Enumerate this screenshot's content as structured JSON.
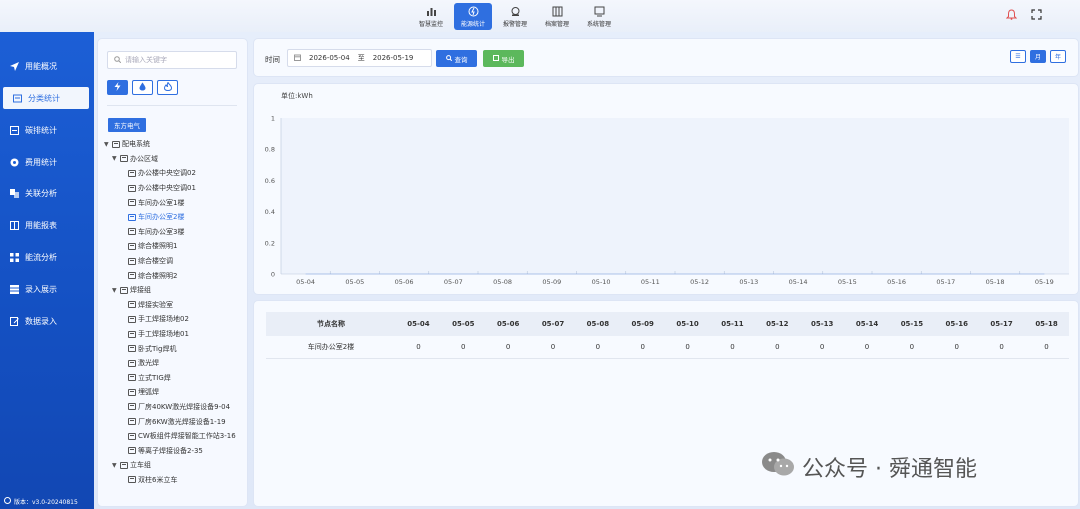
{
  "nav": {
    "items": [
      {
        "label": "智慧监控",
        "icon": "bar-chart-icon"
      },
      {
        "label": "能源统计",
        "icon": "energy-icon",
        "active": true
      },
      {
        "label": "报警管理",
        "icon": "alarm-icon"
      },
      {
        "label": "档案管理",
        "icon": "archive-icon"
      },
      {
        "label": "系统管理",
        "icon": "monitor-icon"
      }
    ]
  },
  "sidebar": {
    "items": [
      {
        "label": "用能概况",
        "icon": "send-icon"
      },
      {
        "label": "分类统计",
        "icon": "category-icon",
        "active": true
      },
      {
        "label": "碳排统计",
        "icon": "carbon-icon"
      },
      {
        "label": "费用统计",
        "icon": "cost-icon"
      },
      {
        "label": "关联分析",
        "icon": "link-icon"
      },
      {
        "label": "用能报表",
        "icon": "report-icon"
      },
      {
        "label": "能流分析",
        "icon": "flow-icon"
      },
      {
        "label": "录入展示",
        "icon": "input-display-icon"
      },
      {
        "label": "数据录入",
        "icon": "data-entry-icon"
      }
    ],
    "version": "版本：v3.0-20240815"
  },
  "tree": {
    "search_placeholder": "请输入关键字",
    "company": "东方电气",
    "nodes": [
      {
        "label": "配电系统",
        "level": 0,
        "caret": true
      },
      {
        "label": "办公区域",
        "level": 1,
        "caret": true
      },
      {
        "label": "办公楼中央空调02",
        "level": 2
      },
      {
        "label": "办公楼中央空调01",
        "level": 2
      },
      {
        "label": "车间办公室1楼",
        "level": 2
      },
      {
        "label": "车间办公室2楼",
        "level": 2,
        "selected": true
      },
      {
        "label": "车间办公室3楼",
        "level": 2
      },
      {
        "label": "综合楼照明1",
        "level": 2
      },
      {
        "label": "综合楼空调",
        "level": 2
      },
      {
        "label": "综合楼照明2",
        "level": 2
      },
      {
        "label": "焊接组",
        "level": 1,
        "caret": true
      },
      {
        "label": "焊接实验室",
        "level": 2
      },
      {
        "label": "手工焊接场地02",
        "level": 2
      },
      {
        "label": "手工焊接场地01",
        "level": 2
      },
      {
        "label": "卧式Tig焊机",
        "level": 2
      },
      {
        "label": "激光焊",
        "level": 2
      },
      {
        "label": "立式TIG焊",
        "level": 2
      },
      {
        "label": "埋弧焊",
        "level": 2
      },
      {
        "label": "厂房40KW激光焊接设备9-04",
        "level": 2
      },
      {
        "label": "厂房6KW激光焊接设备1-19",
        "level": 2
      },
      {
        "label": "CW板组件焊接智能工作站3-16",
        "level": 2
      },
      {
        "label": "等离子焊接设备2-35",
        "level": 2
      },
      {
        "label": "立车组",
        "level": 1,
        "caret": true
      },
      {
        "label": "双柱6米立车",
        "level": 2
      }
    ]
  },
  "toolbar": {
    "time_label": "时间",
    "start_date": "2026-05-04",
    "to_label": "至",
    "end_date": "2026-05-19",
    "query_label": "查询",
    "export_label": "导出",
    "period_buttons": [
      {
        "label": "☰",
        "active": false
      },
      {
        "label": "月",
        "active": true
      },
      {
        "label": "年",
        "active": false
      }
    ]
  },
  "chart_data": {
    "type": "line",
    "unit_label": "单位:kWh",
    "categories": [
      "05-04",
      "05-05",
      "05-06",
      "05-07",
      "05-08",
      "05-09",
      "05-10",
      "05-11",
      "05-12",
      "05-13",
      "05-14",
      "05-15",
      "05-16",
      "05-17",
      "05-18",
      "05-19"
    ],
    "y_ticks": [
      "0",
      "0.2",
      "0.4",
      "0.6",
      "0.8",
      "1"
    ],
    "ylim": [
      0,
      1
    ],
    "series": [
      {
        "name": "车间办公室2楼",
        "values": [
          0,
          0,
          0,
          0,
          0,
          0,
          0,
          0,
          0,
          0,
          0,
          0,
          0,
          0,
          0,
          0
        ]
      }
    ]
  },
  "table": {
    "headers": [
      "节点名称",
      "05-04",
      "05-05",
      "05-06",
      "05-07",
      "05-08",
      "05-09",
      "05-10",
      "05-11",
      "05-12",
      "05-13",
      "05-14",
      "05-15",
      "05-16",
      "05-17",
      "05-18"
    ],
    "rows": [
      [
        "车间办公室2楼",
        "0",
        "0",
        "0",
        "0",
        "0",
        "0",
        "0",
        "0",
        "0",
        "0",
        "0",
        "0",
        "0",
        "0",
        "0"
      ]
    ]
  },
  "watermark": "公众号 · 舜通智能",
  "colors": {
    "primary": "#2f6fe0",
    "sidebar": "#1c5fd6",
    "export": "#5cb85c",
    "alert": "#e05050"
  }
}
